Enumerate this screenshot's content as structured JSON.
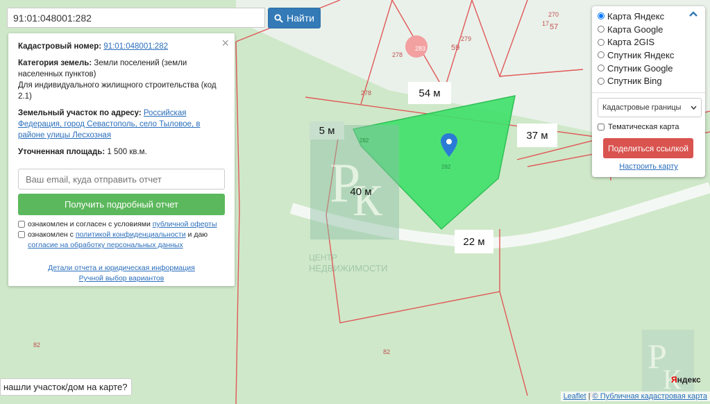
{
  "search": {
    "value": "91:01:048001:282",
    "button_label": "Найти"
  },
  "info": {
    "close_icon": "×",
    "cad_number_label": "Кадастровый номер:",
    "cad_number_value": "91:01:048001:282",
    "category_label": "Категория земель:",
    "category_value": "Земли поселений (земли населенных пунктов)",
    "usage": "Для индивидуального жилищного строительства (код 2.1)",
    "address_label": "Земельный участок по адресу:",
    "address_value": "Российская Федерация, город Севастополь, село Тыловое, в районе улицы Лесхозная",
    "area_label": "Уточненная площадь:",
    "area_value": "1 500 кв.м.",
    "email_placeholder": "Ваш email, куда отправить отчет",
    "report_button": "Получить подробный отчет",
    "agree1_text": "ознакомлен и согласен с условиями",
    "agree1_link": "публичной оферты",
    "agree2_text": "ознакомлен с",
    "agree2_link": "политикой конфиденциальности",
    "agree2_tail": "и даю",
    "agree2_link2": "согласие на обработку персональных данных",
    "details_link": "Детали отчета и юридическая информация",
    "manual_link": "Ручной выбор вариантов"
  },
  "layers": {
    "options": [
      "Карта Яндекс",
      "Карта Google",
      "Карта 2GIS",
      "Спутник Яндекс",
      "Спутник Google",
      "Спутник Bing"
    ],
    "selected": "Карта Яндекс",
    "select_value": "Кадастровые границы",
    "thematic_label": "Тематическая карта",
    "share_button": "Поделиться ссылкой",
    "configure_link": "Настроить карту",
    "collapse_icon": "chevron-up-icon"
  },
  "map": {
    "dims": [
      "54 м",
      "37 м",
      "5 м",
      "40 м",
      "22 м"
    ],
    "parcel_numbers": [
      "270",
      "17",
      "57",
      "279",
      "59",
      "278",
      "283",
      "278",
      "282",
      "282",
      "82",
      "82",
      "59"
    ],
    "watermark_text1": "ЦЕНТР",
    "watermark_text2": "НЕДВИЖИМОСТИ",
    "watermark_letter1": "Р",
    "watermark_letter2": "К"
  },
  "bottom_tip": "нашли участок/дом на карте?",
  "attribution": {
    "leaflet": "Leaflet",
    "sep": "|",
    "copyright": "© Публичная кадастровая карта"
  },
  "yandex_logo": {
    "first": "Я",
    "rest": "ндекс"
  },
  "colors": {
    "parcel_fill": "#3ee06a",
    "boundary": "#e05858",
    "accent": "#337ab7",
    "report": "#5cb85c",
    "share": "#d9534f"
  }
}
